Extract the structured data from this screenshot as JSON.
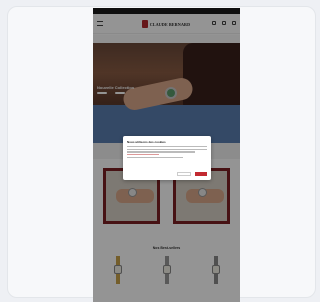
{
  "brand": {
    "name": "CLAUDE BERNARD",
    "accent": "#c22a31"
  },
  "status_bar": {
    "left": "",
    "right": ""
  },
  "nav": {
    "items": [
      "",
      "",
      "",
      "",
      "",
      "",
      ""
    ]
  },
  "hero": {
    "title": "Nouvelle Collection",
    "buttons": [
      "",
      ""
    ]
  },
  "cookie_modal": {
    "title": "Nous utilisons des cookies",
    "reject_label": "",
    "accept_label": ""
  },
  "section": {
    "title": "Nos Best-sellers"
  },
  "products": [
    {
      "name": "",
      "price": "",
      "strap": "#c9a24a"
    },
    {
      "name": "",
      "price": "",
      "strap": "#9a9a9a"
    },
    {
      "name": "",
      "price": "",
      "strap": "#8a8a8a"
    }
  ]
}
